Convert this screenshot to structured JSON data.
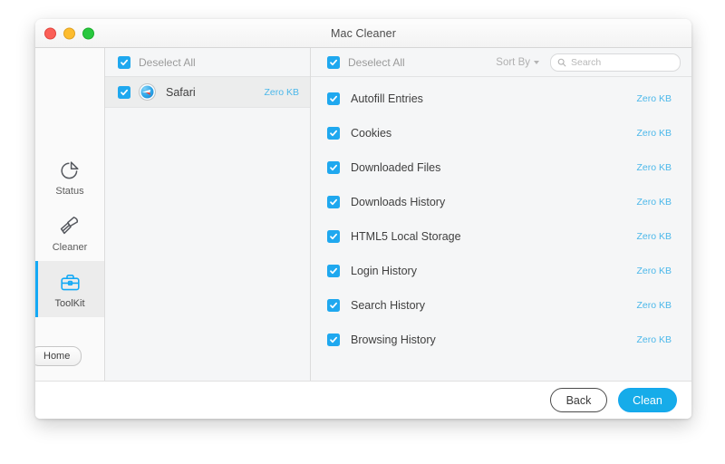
{
  "window": {
    "title": "Mac Cleaner",
    "traffic_lights": [
      {
        "name": "close",
        "color": "#fb5f57"
      },
      {
        "name": "minimize",
        "color": "#fdbc2e"
      },
      {
        "name": "maximize",
        "color": "#29c83f"
      }
    ]
  },
  "sidebar": {
    "items": [
      {
        "label": "Status",
        "icon": "pie-chart-icon",
        "active": false
      },
      {
        "label": "Cleaner",
        "icon": "brush-icon",
        "active": false
      },
      {
        "label": "ToolKit",
        "icon": "toolbox-icon",
        "active": true
      }
    ],
    "home_label": "Home",
    "accent_color": "#13a9f5"
  },
  "apps_panel": {
    "header": {
      "deselect_label": "Deselect All",
      "checked": true
    },
    "rows": [
      {
        "name": "Safari",
        "size": "Zero KB",
        "checked": true,
        "selected": true,
        "icon": "safari-compass-icon"
      }
    ]
  },
  "detail_panel": {
    "header": {
      "deselect_label": "Deselect All",
      "checked": true,
      "sort_by_label": "Sort By",
      "search_placeholder": "Search",
      "search_value": ""
    },
    "rows": [
      {
        "name": "Autofill Entries",
        "size": "Zero KB",
        "checked": true
      },
      {
        "name": "Cookies",
        "size": "Zero KB",
        "checked": true
      },
      {
        "name": "Downloaded Files",
        "size": "Zero KB",
        "checked": true
      },
      {
        "name": "Downloads History",
        "size": "Zero KB",
        "checked": true
      },
      {
        "name": "HTML5 Local Storage",
        "size": "Zero KB",
        "checked": true
      },
      {
        "name": "Login History",
        "size": "Zero KB",
        "checked": true
      },
      {
        "name": "Search History",
        "size": "Zero KB",
        "checked": true
      },
      {
        "name": "Browsing History",
        "size": "Zero KB",
        "checked": true
      }
    ],
    "size_color": "#4cb8ea"
  },
  "footer": {
    "back_label": "Back",
    "clean_label": "Clean",
    "clean_color": "#16ace9"
  }
}
